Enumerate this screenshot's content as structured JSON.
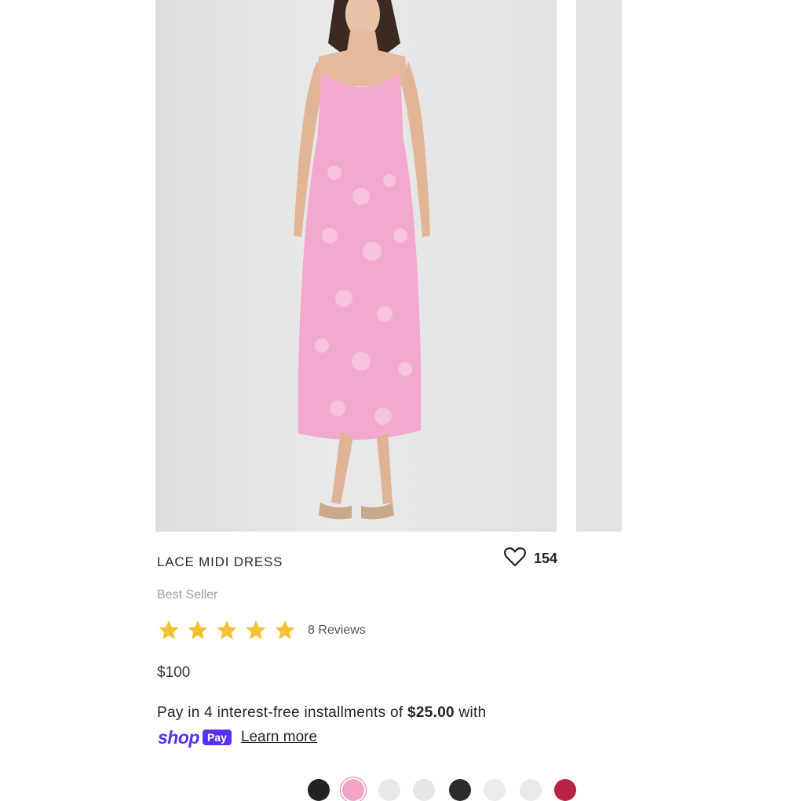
{
  "product": {
    "title": "LACE MIDI DRESS",
    "badge": "Best Seller",
    "wishlist_count": "154",
    "rating": 5,
    "reviews_label": "8 Reviews",
    "price": "$100"
  },
  "installments": {
    "prefix": "Pay in 4 interest-free installments of ",
    "amount": "$25.00",
    "suffix": " with",
    "brand_shop": "shop",
    "brand_pay": "Pay",
    "learn_more": "Learn more"
  },
  "colors": {
    "star": "#f5c033",
    "shop_pay": "#5a31f4",
    "dress": "#f3a9cf",
    "image_bg": "#e4e4e4"
  },
  "icons": {
    "wishlist": "heart-icon",
    "rating": "star-icon"
  },
  "swatch_colors": [
    "#222222",
    "#f0a4c8",
    "#e8e8e8",
    "#e6e6e6",
    "#2b2b2b",
    "#ececec",
    "#e9e9e9",
    "#b8234a"
  ]
}
